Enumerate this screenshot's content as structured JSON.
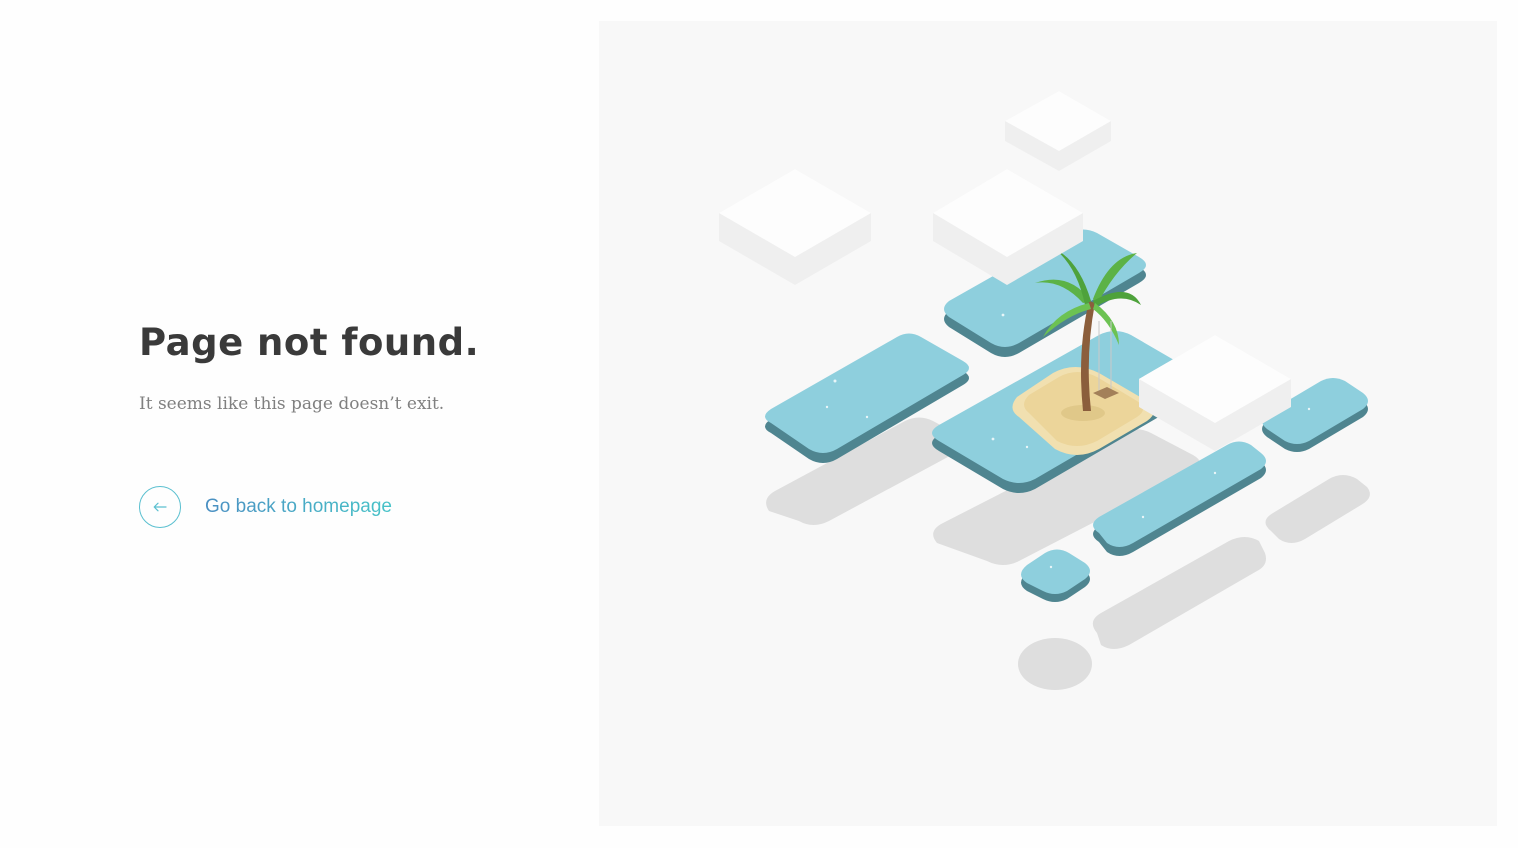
{
  "page": {
    "title": "Page not found.",
    "subtitle": "It seems like this page doesn’t exit.",
    "back_link": {
      "label": "Go back to homepage",
      "icon": "arrow-left-icon"
    }
  },
  "illustration": {
    "description_icon": "island-palm-illustration"
  },
  "colors": {
    "title": "#3a3a3a",
    "subtitle": "#808080",
    "accent": "#4aa3c8",
    "water": "#8ecfdd",
    "water_edge": "#4f8590",
    "sand": "#ecd59a",
    "palm_leaf": "#5cb246",
    "trunk": "#8b5e3c",
    "cloud": "#fdfdfd",
    "panel_bg": "#f8f8f8"
  }
}
